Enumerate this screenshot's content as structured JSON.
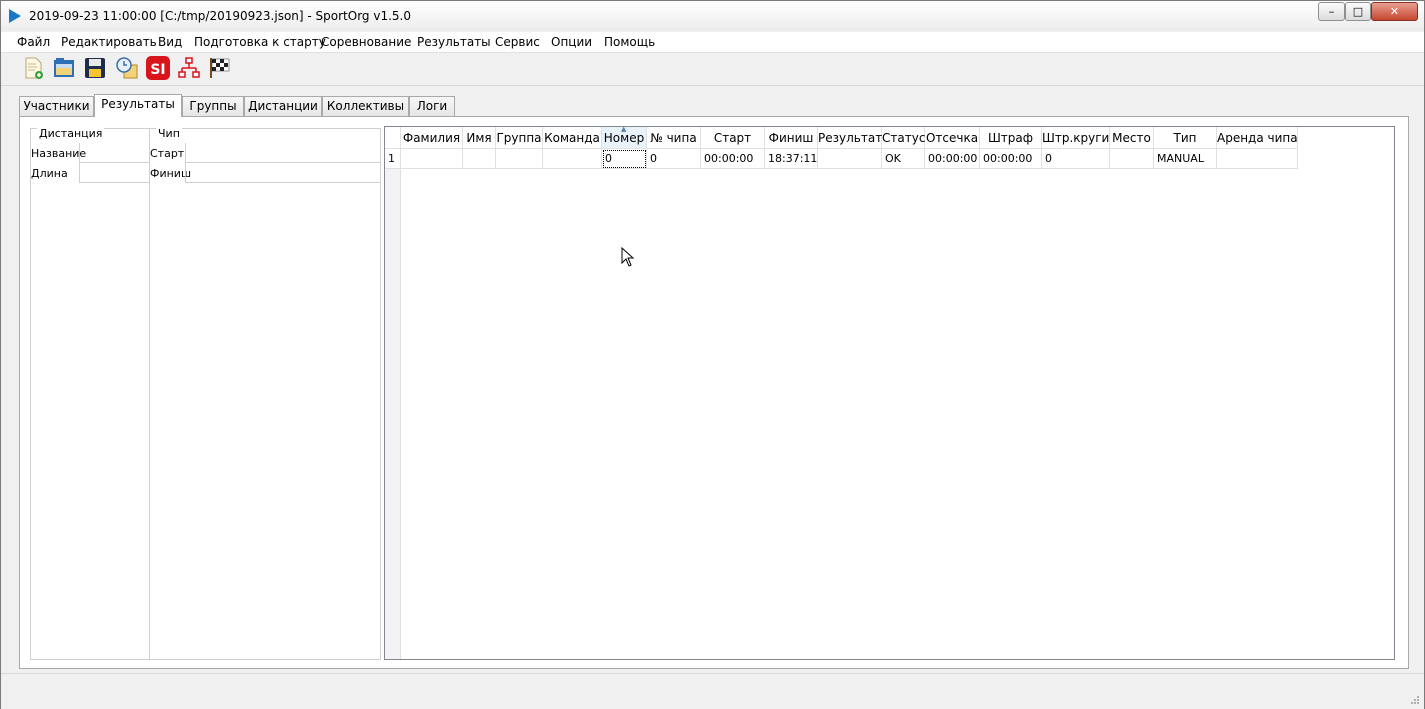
{
  "window": {
    "title": "2019-09-23 11:00:00 [C:/tmp/20190923.json] - SportOrg v1.5.0",
    "controls": {
      "minimize": "–",
      "maximize": "□",
      "close": "✕"
    }
  },
  "menu": [
    "Файл",
    "Редактировать",
    "Вид",
    "Подготовка к старту",
    "Соревнование",
    "Результаты",
    "Сервис",
    "Опции",
    "Помощь"
  ],
  "toolbar": {
    "icons": [
      "new-file-icon",
      "open-folder-icon",
      "save-icon",
      "clock-icon",
      "si-reader-icon",
      "network-icon",
      "checkered-flag-icon"
    ],
    "si_label": "SI"
  },
  "tabs": [
    "Участники",
    "Результаты",
    "Группы",
    "Дистанции",
    "Коллективы",
    "Логи"
  ],
  "active_tab": "Результаты",
  "left_panel": {
    "distance_group": {
      "title": "Дистанция",
      "name_label": "Название",
      "length_label": "Длина"
    },
    "chip_group": {
      "title": "Чип",
      "start_label": "Старт",
      "finish_label": "Финиш"
    }
  },
  "table": {
    "columns": [
      "Фамилия",
      "Имя",
      "Группа",
      "Команда",
      "Номер",
      "№ чипа",
      "Старт",
      "Финиш",
      "Результат",
      "Статус",
      "Отсечка",
      "Штраф",
      "Штр.круги",
      "Место",
      "Тип",
      "Аренда чипа"
    ],
    "sorted_column": "Номер",
    "rows": [
      {
        "index": "1",
        "cells": [
          "",
          "",
          "",
          "",
          "0",
          "0",
          "00:00:00",
          "18:37:11",
          "",
          "OK",
          "00:00:00",
          "00:00:00",
          "0",
          "",
          "MANUAL",
          ""
        ]
      }
    ]
  },
  "colors": {
    "accent": "#1a77c9",
    "close_button": "#c6462f",
    "si_red": "#d9141b"
  }
}
